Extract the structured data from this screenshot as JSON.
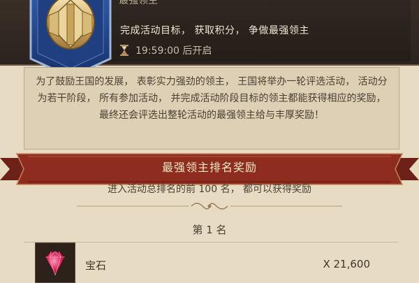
{
  "header": {
    "title": "最强领主",
    "goal": "完成活动目标， 获取积分， 争做最强领主",
    "timer": "19:59:00 后开启"
  },
  "description": "为了鼓励王国的发展， 表彰实力强劲的领主， 王国将举办一轮评选活动， 活动分为若干阶段， 所有参加活动， 并完成活动阶段目标的领主都能获得相应的奖励， 最终还会评选出整轮活动的最强领主给与丰厚奖励！",
  "rewards_section": {
    "title": "最强领主排名奖励",
    "note": "进入活动总排名的前 100 名， 都可以获得奖励",
    "rank_label": "第 1 名",
    "items": [
      {
        "name": "宝石",
        "quantity": "X 21,600",
        "icon": "gem-icon"
      }
    ]
  },
  "colors": {
    "ribbon": "#8e2d1f",
    "header_bg": "#2b231d",
    "panel": "#ded0b5"
  }
}
